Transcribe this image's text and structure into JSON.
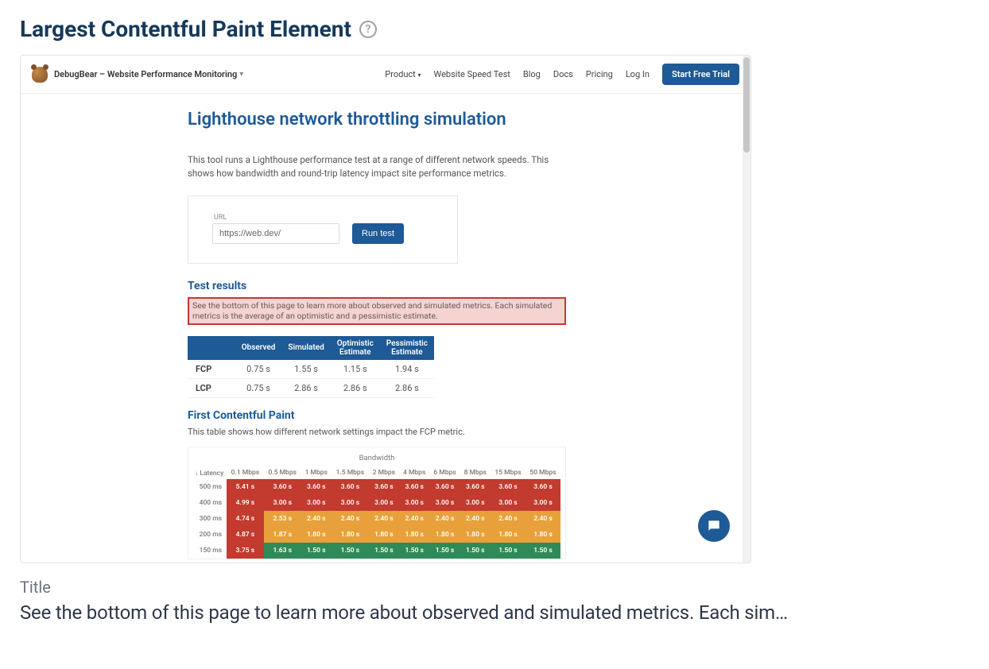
{
  "section_title": "Largest Contentful Paint Element",
  "caption_label": "Title",
  "caption_text": "See the bottom of this page to learn more about observed and simulated metrics. Each simulated metrics is the average of an optimistic and a pessimistic estimate.",
  "inner": {
    "brand": "DebugBear – Website Performance Monitoring",
    "nav": {
      "product": "Product",
      "speedtest": "Website Speed Test",
      "blog": "Blog",
      "docs": "Docs",
      "pricing": "Pricing",
      "login": "Log In",
      "cta": "Start Free Trial"
    },
    "page_heading": "Lighthouse network throttling simulation",
    "intro": "This tool runs a Lighthouse performance test at a range of different network speeds. This shows how bandwidth and round-trip latency impact site performance metrics.",
    "url_label": "URL",
    "url_value": "https://web.dev/",
    "run_label": "Run test",
    "results_heading": "Test results",
    "highlight": "See the bottom of this page to learn more about observed and simulated metrics. Each simulated metrics is the average of an optimistic and a pessimistic estimate.",
    "metrics_headers": {
      "observed": "Observed",
      "simulated": "Simulated",
      "optimistic": "Optimistic Estimate",
      "pessimistic": "Pessimistic Estimate"
    },
    "metrics_rows": [
      {
        "label": "FCP",
        "observed": "0.75 s",
        "simulated": "1.55 s",
        "optimistic": "1.15 s",
        "pessimistic": "1.94 s"
      },
      {
        "label": "LCP",
        "observed": "0.75 s",
        "simulated": "2.86 s",
        "optimistic": "2.86 s",
        "pessimistic": "2.86 s"
      }
    ],
    "fcp_heading": "First Contentful Paint",
    "fcp_intro": "This table shows how different network settings impact the FCP metric.",
    "bandwidth_label": "Bandwidth",
    "latency_axis": "↓ Latency",
    "bw_headers": [
      "0.1 Mbps",
      "0.5 Mbps",
      "1 Mbps",
      "1.5 Mbps",
      "2 Mbps",
      "4 Mbps",
      "6 Mbps",
      "8 Mbps",
      "15 Mbps",
      "50 Mbps"
    ],
    "heat_rows": [
      {
        "label": "500 ms",
        "cls": "c-red",
        "first": "5.41 s",
        "firstcls": "c-red",
        "rest": "3.60 s"
      },
      {
        "label": "400 ms",
        "cls": "c-red",
        "first": "4.99 s",
        "firstcls": "c-red",
        "rest": "3.00 s"
      },
      {
        "label": "300 ms",
        "cls": "c-orange",
        "first": "4.74 s",
        "firstcls": "c-red",
        "second": "2.53 s",
        "rest": "2.40 s"
      },
      {
        "label": "200 ms",
        "cls": "c-orange",
        "first": "4.87 s",
        "firstcls": "c-red",
        "second": "1.87 s",
        "rest": "1.80 s"
      },
      {
        "label": "150 ms",
        "cls": "c-green",
        "first": "3.75 s",
        "firstcls": "c-red",
        "second": "1.63 s",
        "rest": "1.50 s"
      }
    ]
  }
}
